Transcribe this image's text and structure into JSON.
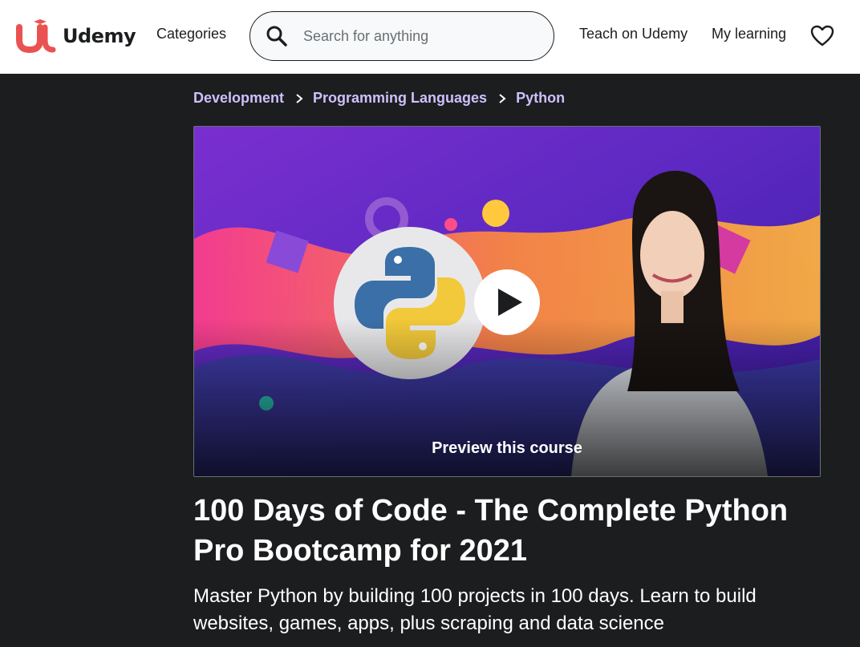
{
  "header": {
    "logo_text": "Udemy",
    "categories_label": "Categories",
    "search_placeholder": "Search for anything",
    "search_value": "",
    "teach_label": "Teach on Udemy",
    "my_learning_label": "My learning",
    "icons": [
      "search-icon",
      "heart-icon"
    ],
    "brand_color": "#ea5252"
  },
  "breadcrumb": {
    "items": [
      "Development",
      "Programming Languages",
      "Python"
    ],
    "color": "#cec0fc"
  },
  "preview": {
    "label": "Preview this course",
    "icon": "play-icon"
  },
  "course": {
    "title": "100 Days of Code - The Complete Python Pro Bootcamp for 2021",
    "subtitle": "Master Python by building 100 projects in 100 days. Learn to build websites, games, apps, plus scraping and data science"
  },
  "colors": {
    "page_bg": "#1c1d1f",
    "header_bg": "#ffffff",
    "text": "#ffffff"
  }
}
